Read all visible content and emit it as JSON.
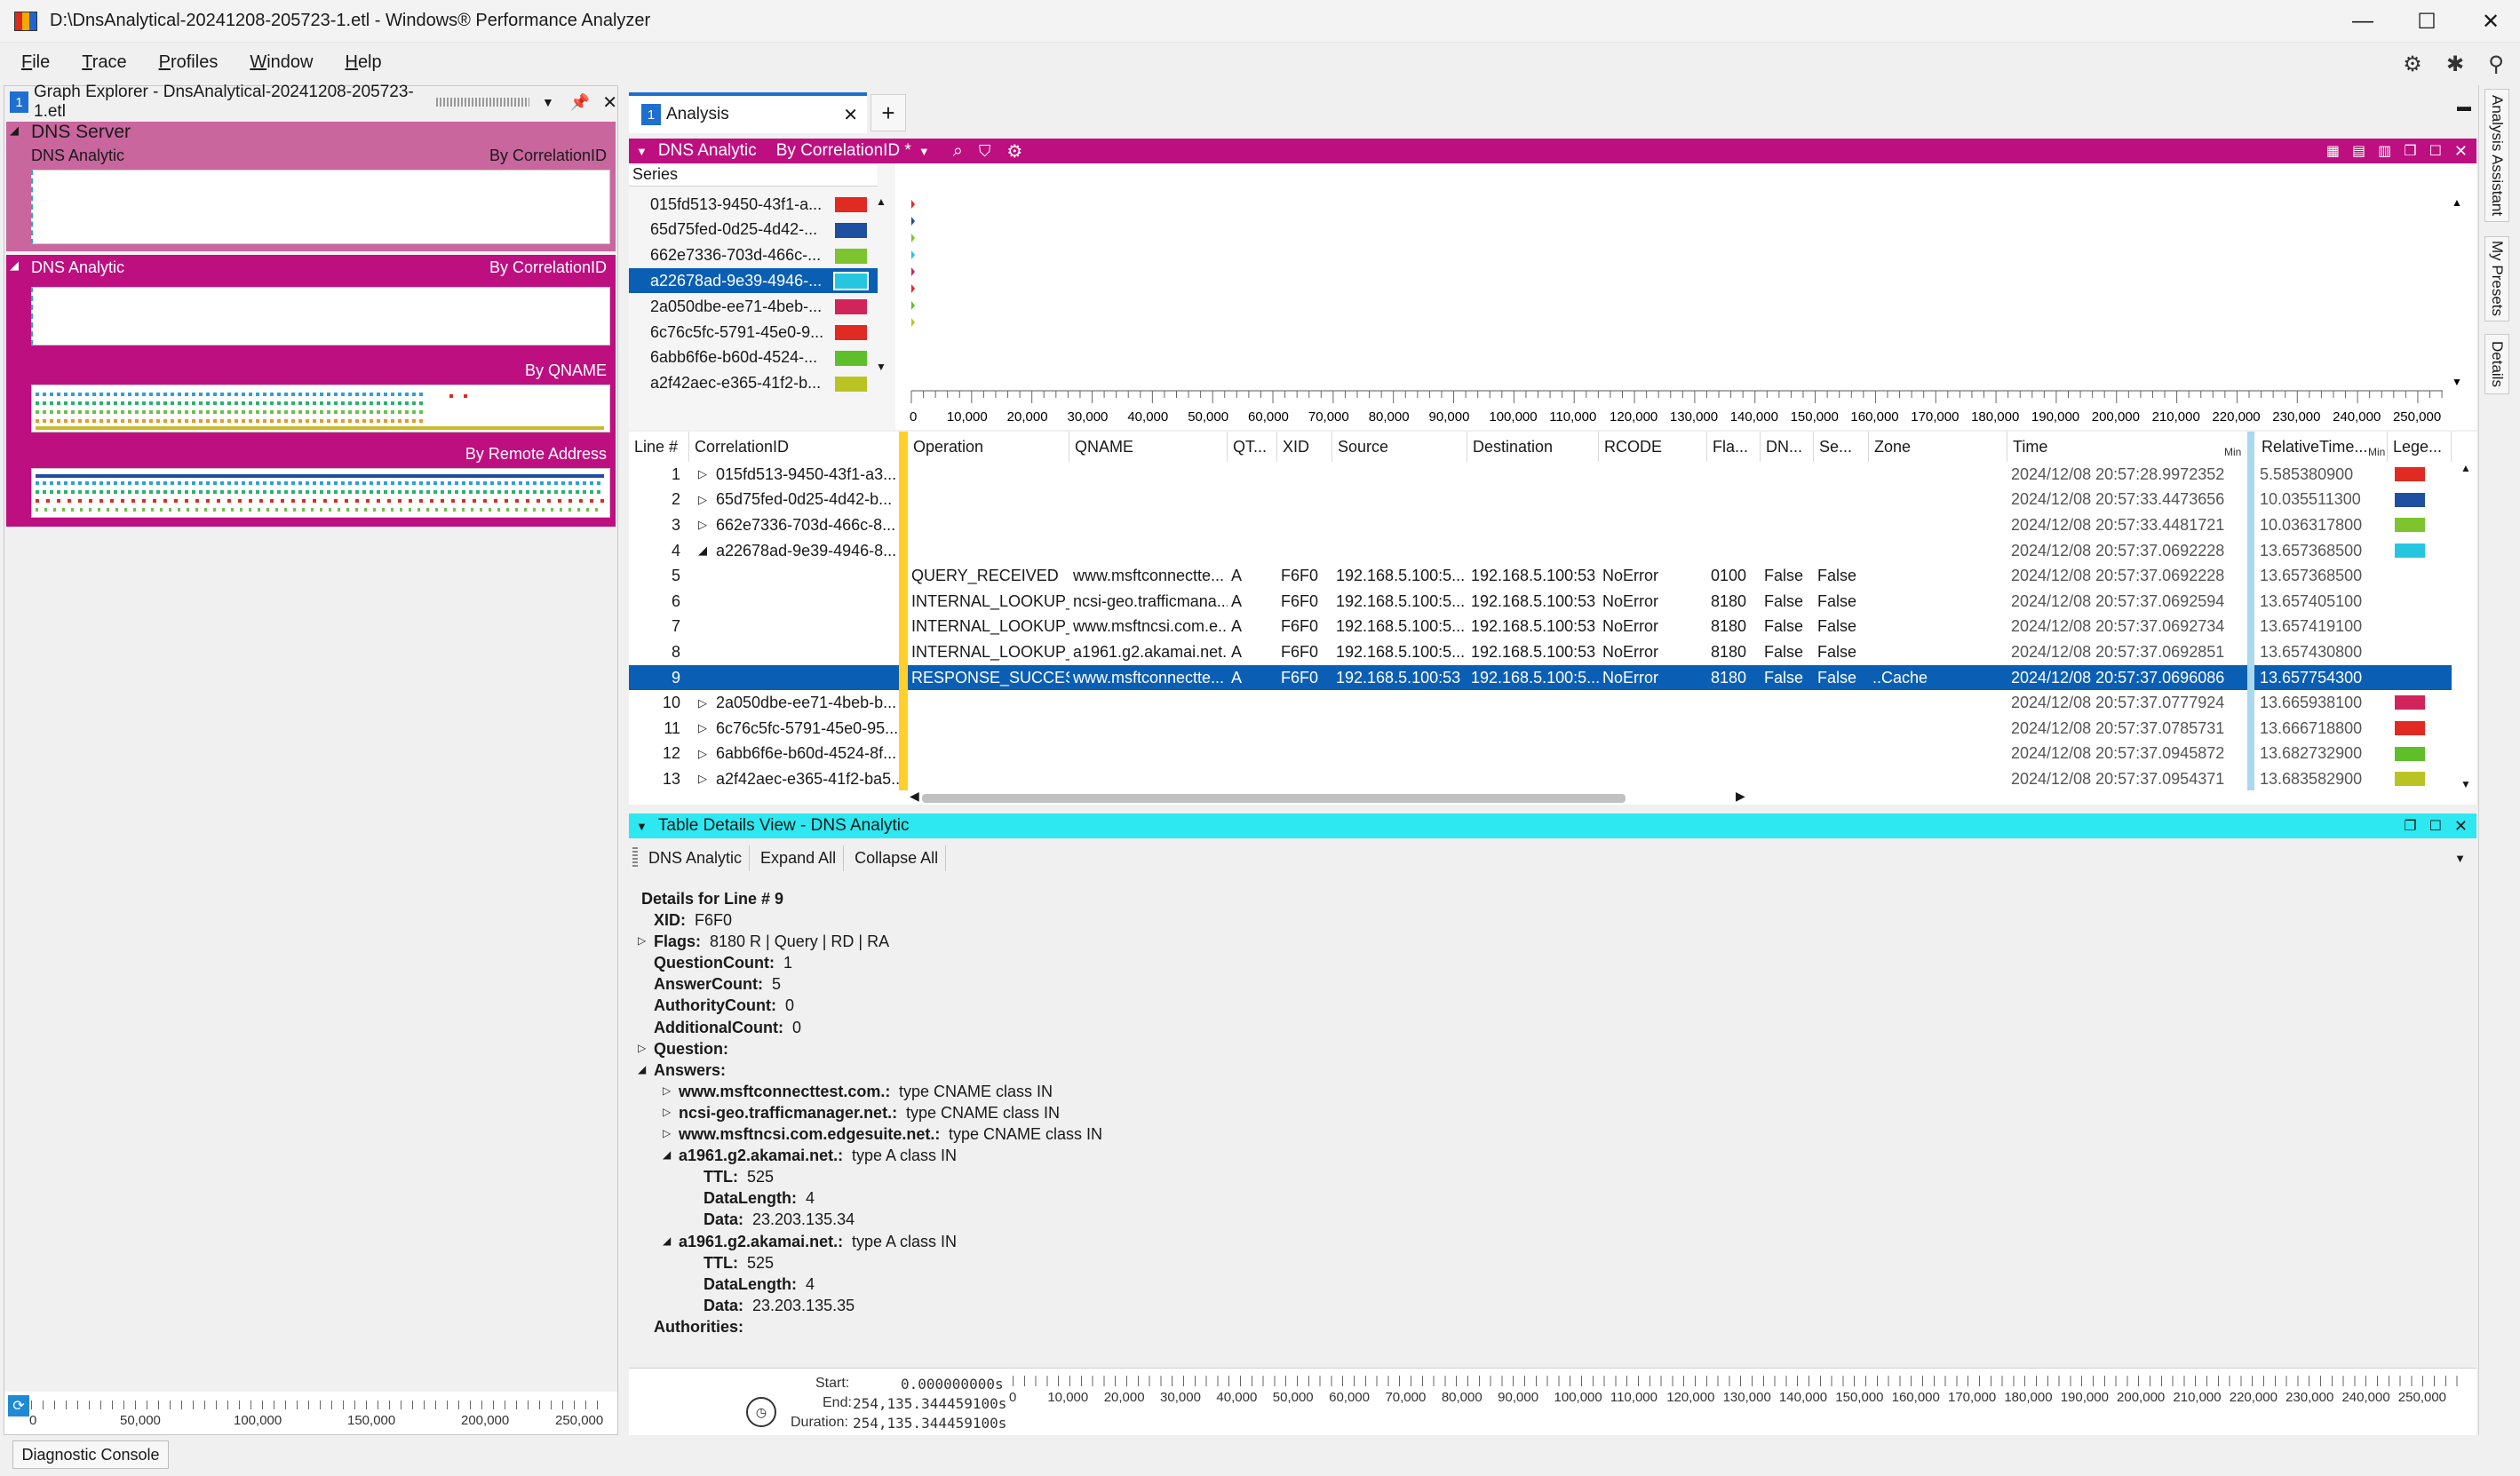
{
  "window": {
    "title": "D:\\DnsAnalytical-20241208-205723-1.etl - Windows® Performance Analyzer"
  },
  "menu": [
    "File",
    "Trace",
    "Profiles",
    "Window",
    "Help"
  ],
  "graph_explorer": {
    "badge": "1",
    "title": "Graph Explorer - DnsAnalytical-20241208-205723-1.etl",
    "groups": [
      {
        "name": "DNS Server",
        "sub": "DNS Analytic",
        "right": "By CorrelationID"
      },
      {
        "name": "DNS Analytic",
        "right": "By CorrelationID",
        "extra": [
          "By QNAME",
          "By Remote Address"
        ]
      }
    ],
    "axis": [
      "0",
      "50,000",
      "100,000",
      "150,000",
      "200,000",
      "250,000"
    ]
  },
  "analysis": {
    "tab_badge": "1",
    "tab_label": "Analysis",
    "graph_title": "DNS Analytic",
    "preset": "By CorrelationID *",
    "series_header": "Series",
    "series": [
      {
        "name": "015fd513-9450-43f1-a...",
        "color": "#e02a22"
      },
      {
        "name": "65d75fed-0d25-4d42-...",
        "color": "#1f4fa0"
      },
      {
        "name": "662e7336-703d-466c-...",
        "color": "#7dc42e"
      },
      {
        "name": "a22678ad-9e39-4946-...",
        "color": "#27c6e0"
      },
      {
        "name": "2a050dbe-ee71-4beb-...",
        "color": "#d0245a"
      },
      {
        "name": "6c76c5fc-5791-45e0-9...",
        "color": "#e02a22"
      },
      {
        "name": "6abb6f6e-b60d-4524-...",
        "color": "#5fbf2a"
      },
      {
        "name": "a2f42aec-e365-41f2-b...",
        "color": "#b9c424"
      }
    ],
    "x_axis": [
      "10,000",
      "20,000",
      "30,000",
      "40,000",
      "50,000",
      "60,000",
      "70,000",
      "80,000",
      "90,000",
      "100,000",
      "110,000",
      "120,000",
      "130,000",
      "140,000",
      "150,000",
      "160,000",
      "170,000",
      "180,000",
      "190,000",
      "200,000",
      "210,000",
      "220,000",
      "230,000",
      "240,000",
      "250,000"
    ],
    "x_axis_zero": "0"
  },
  "table": {
    "columns": [
      "Line #",
      "CorrelationID",
      "Operation",
      "QNAME",
      "QT...",
      "XID",
      "Source",
      "Destination",
      "RCODE",
      "Fla...",
      "DN...",
      "Se...",
      "Zone",
      "Time",
      "RelativeTime...",
      "Lege..."
    ],
    "min_label": "Min",
    "rows": [
      {
        "line": "1",
        "corr": "015fd513-9450-43f1-a3...",
        "exp": "▷",
        "time": "2024/12/08 20:57:28.9972352",
        "rel": "5.585380900",
        "legend": "#e02a22"
      },
      {
        "line": "2",
        "corr": "65d75fed-0d25-4d42-b...",
        "exp": "▷",
        "time": "2024/12/08 20:57:33.4473656",
        "rel": "10.035511300",
        "legend": "#1f4fa0"
      },
      {
        "line": "3",
        "corr": "662e7336-703d-466c-8...",
        "exp": "▷",
        "time": "2024/12/08 20:57:33.4481721",
        "rel": "10.036317800",
        "legend": "#7dc42e"
      },
      {
        "line": "4",
        "corr": "a22678ad-9e39-4946-8...",
        "exp": "◢",
        "time": "2024/12/08 20:57:37.0692228",
        "rel": "13.657368500",
        "legend": "#27c6e0"
      },
      {
        "line": "5",
        "op": "QUERY_RECEIVED",
        "qname": "www.msftconnectte...",
        "qt": "A",
        "xid": "F6F0",
        "src": "192.168.5.100:5...",
        "dst": "192.168.5.100:53",
        "rcode": "NoError",
        "flags": "0100",
        "dn": "False",
        "se": "False",
        "time": "2024/12/08 20:57:37.0692228",
        "rel": "13.657368500"
      },
      {
        "line": "6",
        "op": "INTERNAL_LOOKUP_...",
        "qname": "ncsi-geo.trafficmana...",
        "qt": "A",
        "xid": "F6F0",
        "src": "192.168.5.100:5...",
        "dst": "192.168.5.100:53",
        "rcode": "NoError",
        "flags": "8180",
        "dn": "False",
        "se": "False",
        "time": "2024/12/08 20:57:37.0692594",
        "rel": "13.657405100"
      },
      {
        "line": "7",
        "op": "INTERNAL_LOOKUP_...",
        "qname": "www.msftncsi.com.e...",
        "qt": "A",
        "xid": "F6F0",
        "src": "192.168.5.100:5...",
        "dst": "192.168.5.100:53",
        "rcode": "NoError",
        "flags": "8180",
        "dn": "False",
        "se": "False",
        "time": "2024/12/08 20:57:37.0692734",
        "rel": "13.657419100"
      },
      {
        "line": "8",
        "op": "INTERNAL_LOOKUP_...",
        "qname": "a1961.g2.akamai.net.",
        "qt": "A",
        "xid": "F6F0",
        "src": "192.168.5.100:5...",
        "dst": "192.168.5.100:53",
        "rcode": "NoError",
        "flags": "8180",
        "dn": "False",
        "se": "False",
        "time": "2024/12/08 20:57:37.0692851",
        "rel": "13.657430800"
      },
      {
        "line": "9",
        "op": "RESPONSE_SUCCESS",
        "qname": "www.msftconnectte...",
        "qt": "A",
        "xid": "F6F0",
        "src": "192.168.5.100:53",
        "dst": "192.168.5.100:5...",
        "rcode": "NoError",
        "flags": "8180",
        "dn": "False",
        "se": "False",
        "zone": "..Cache",
        "time": "2024/12/08 20:57:37.0696086",
        "rel": "13.657754300",
        "selected": true
      },
      {
        "line": "10",
        "corr": "2a050dbe-ee71-4beb-b...",
        "exp": "▷",
        "time": "2024/12/08 20:57:37.0777924",
        "rel": "13.665938100",
        "legend": "#d0245a"
      },
      {
        "line": "11",
        "corr": "6c76c5fc-5791-45e0-95...",
        "exp": "▷",
        "time": "2024/12/08 20:57:37.0785731",
        "rel": "13.666718800",
        "legend": "#e02a22"
      },
      {
        "line": "12",
        "corr": "6abb6f6e-b60d-4524-8f...",
        "exp": "▷",
        "time": "2024/12/08 20:57:37.0945872",
        "rel": "13.682732900",
        "legend": "#5fbf2a"
      },
      {
        "line": "13",
        "corr": "a2f42aec-e365-41f2-ba5...",
        "exp": "▷",
        "time": "2024/12/08 20:57:37.0954371",
        "rel": "13.683582900",
        "legend": "#b9c424"
      }
    ]
  },
  "details": {
    "bar_title": "Table Details View - DNS Analytic",
    "dropdown": "DNS Analytic",
    "expand_all": "Expand All",
    "collapse_all": "Collapse All",
    "heading": "Details for Line # 9",
    "lines": [
      {
        "k": "XID:",
        "v": "F6F0",
        "i": 0,
        "t": ""
      },
      {
        "k": "Flags:",
        "v": "8180 R | Query | RD | RA",
        "i": 0,
        "t": "▷"
      },
      {
        "k": "QuestionCount:",
        "v": "1",
        "i": 0,
        "t": ""
      },
      {
        "k": "AnswerCount:",
        "v": "5",
        "i": 0,
        "t": ""
      },
      {
        "k": "AuthorityCount:",
        "v": "0",
        "i": 0,
        "t": ""
      },
      {
        "k": "AdditionalCount:",
        "v": "0",
        "i": 0,
        "t": ""
      },
      {
        "k": "Question:",
        "v": "",
        "i": 0,
        "t": "▷"
      },
      {
        "k": "Answers:",
        "v": "",
        "i": 0,
        "t": "◢"
      },
      {
        "k": "www.msftconnecttest.com.:",
        "v": "type CNAME class IN",
        "i": 1,
        "t": "▷"
      },
      {
        "k": "ncsi-geo.trafficmanager.net.:",
        "v": "type CNAME class IN",
        "i": 1,
        "t": "▷"
      },
      {
        "k": "www.msftncsi.com.edgesuite.net.:",
        "v": "type CNAME class IN",
        "i": 1,
        "t": "▷"
      },
      {
        "k": "a1961.g2.akamai.net.:",
        "v": "type A class IN",
        "i": 1,
        "t": "◢"
      },
      {
        "k": "TTL:",
        "v": "525",
        "i": 2,
        "t": ""
      },
      {
        "k": "DataLength:",
        "v": "4",
        "i": 2,
        "t": ""
      },
      {
        "k": "Data:",
        "v": "23.203.135.34",
        "i": 2,
        "t": ""
      },
      {
        "k": "a1961.g2.akamai.net.:",
        "v": "type A class IN",
        "i": 1,
        "t": "◢"
      },
      {
        "k": "TTL:",
        "v": "525",
        "i": 2,
        "t": ""
      },
      {
        "k": "DataLength:",
        "v": "4",
        "i": 2,
        "t": ""
      },
      {
        "k": "Data:",
        "v": "23.203.135.35",
        "i": 2,
        "t": ""
      },
      {
        "k": "Authorities:",
        "v": "",
        "i": 0,
        "t": ""
      }
    ]
  },
  "time_range": {
    "start_label": "Start:",
    "start": "0.000000000s",
    "end_label": "End:",
    "end": "254,135.344459100s",
    "duration_label": "Duration:",
    "duration": "254,135.344459100s"
  },
  "right_rail": [
    "Analysis Assistant",
    "My Presets",
    "Details"
  ],
  "diagnostic_console": "Diagnostic Console"
}
